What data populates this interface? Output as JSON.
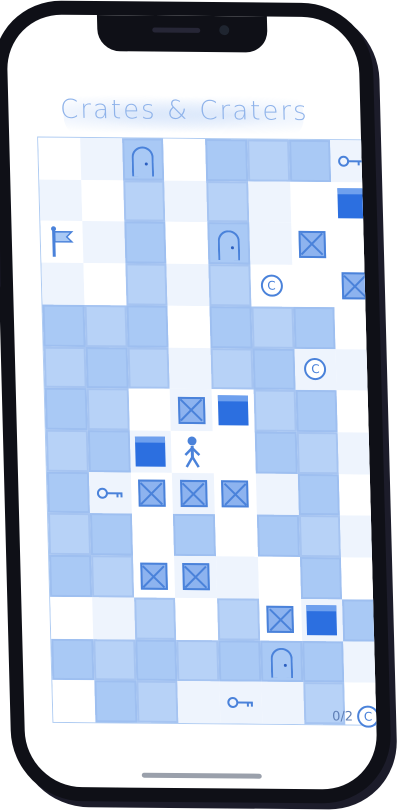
{
  "app": {
    "title": "Crates & Craters"
  },
  "hud": {
    "coins_collected": "0/2",
    "coin_glyph": "C"
  },
  "colors": {
    "accent": "#4a82da",
    "pit": "#a9c9f5",
    "block": "#2c6fe0",
    "title": "#8fb3ea"
  },
  "board": {
    "columns": 8,
    "rows": 14,
    "legend": {
      "L": "floor-light",
      "D": "floor-dark",
      "P": "crater",
      "Q": "crater",
      "X": "crate",
      "B": "solid-block",
      "O": "door",
      "C": "coin",
      "K": "key",
      "F": "flag",
      "H": "player"
    },
    "grid": [
      "LDOLPPPK",
      "DLPDPDLB",
      "FDPLODXL",
      "DLPDPCLX",
      "PPPLPPPL",
      "PPPDPPCD",
      "PPLXBPPL",
      "PPBHLPPD",
      "PKXXXDPL",
      "PPLPLPPD",
      "PPXXDLPL",
      "LDPLPXBP",
      "PPPPPOPD",
      "LPPDKDPL"
    ]
  }
}
